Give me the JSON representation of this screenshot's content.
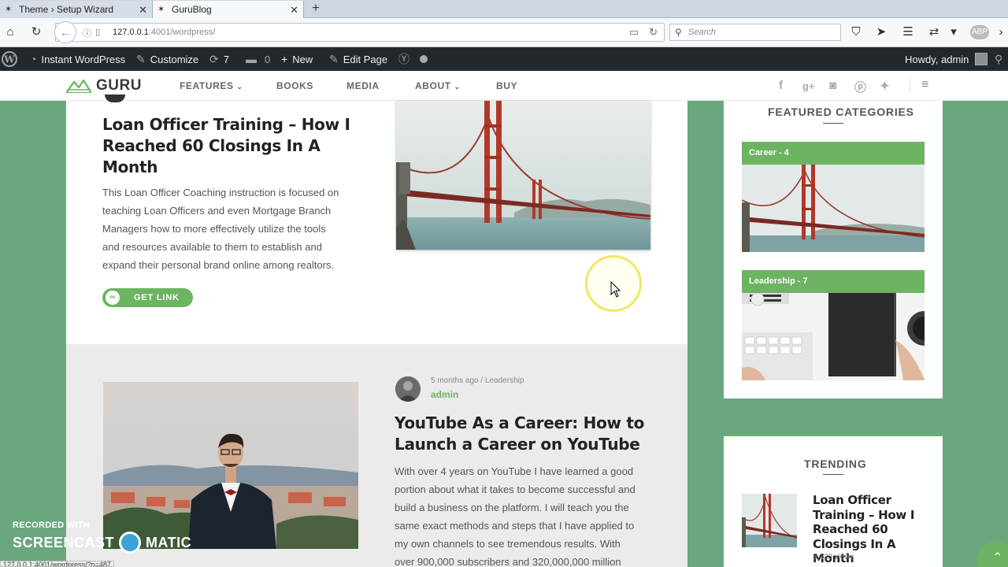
{
  "browser": {
    "tabs": [
      {
        "label": "Theme › Setup Wizard",
        "active": false
      },
      {
        "label": "GuruBlog",
        "active": true
      }
    ],
    "url_host": "127.0.0.1",
    "url_rest": ":4001/wordpress/",
    "search_placeholder": "Search",
    "status_url": "127.0.0.1:4001/wordpress/?p=487"
  },
  "adminbar": {
    "site": "Instant WordPress",
    "customize": "Customize",
    "updates_count": "7",
    "comments_count": "0",
    "new": "New",
    "edit_page": "Edit Page",
    "howdy": "Howdy, admin"
  },
  "header": {
    "logo": "GURU",
    "menu": [
      "FEATURES",
      "BOOKS",
      "MEDIA",
      "ABOUT",
      "BUY"
    ]
  },
  "posts": [
    {
      "title_lines": [
        "Loan Officer Training – How I",
        "Reached 60 Closings In A",
        "Month"
      ],
      "excerpt_lines": [
        "This Loan Officer Coaching instruction is focused on",
        "teaching Loan Officers and even Mortgage Branch",
        "Managers how to more effectively utilize the tools",
        "and resources available to them to establish and",
        "expand their personal brand online among realtors."
      ],
      "button": "GET LINK"
    },
    {
      "meta": "5 months ago / Leadership",
      "author": "admin",
      "title_lines": [
        "YouTube As a Career: How to",
        "Launch a Career on YouTube"
      ],
      "excerpt_lines": [
        "With over 4 years on YouTube I have learned a good",
        "portion about what it takes to become successful and",
        "build a business on the platform. I will teach you the",
        "same exact methods and steps that I have applied to",
        "my own channels to see tremendous results. With",
        "over 900,000 subscribers and 320,000,000 million"
      ]
    }
  ],
  "sidebar": {
    "featured_heading": "FEATURED CATEGORIES",
    "categories": [
      {
        "label": "Career - 4"
      },
      {
        "label": "Leadership - 7"
      }
    ],
    "trending_heading": "TRENDING",
    "trending": [
      {
        "title_lines": [
          "Loan Officer",
          "Training – How I",
          "Reached 60",
          "Closings In A Month"
        ],
        "views": "3,133 views"
      }
    ]
  },
  "watermark": {
    "recorded": "RECORDED WITH",
    "brand_left": "SCREENCAST",
    "brand_right": "MATIC"
  },
  "colors": {
    "accent": "#6cb461",
    "admin_bar": "#23282d",
    "page_bg": "#6aa77f"
  }
}
